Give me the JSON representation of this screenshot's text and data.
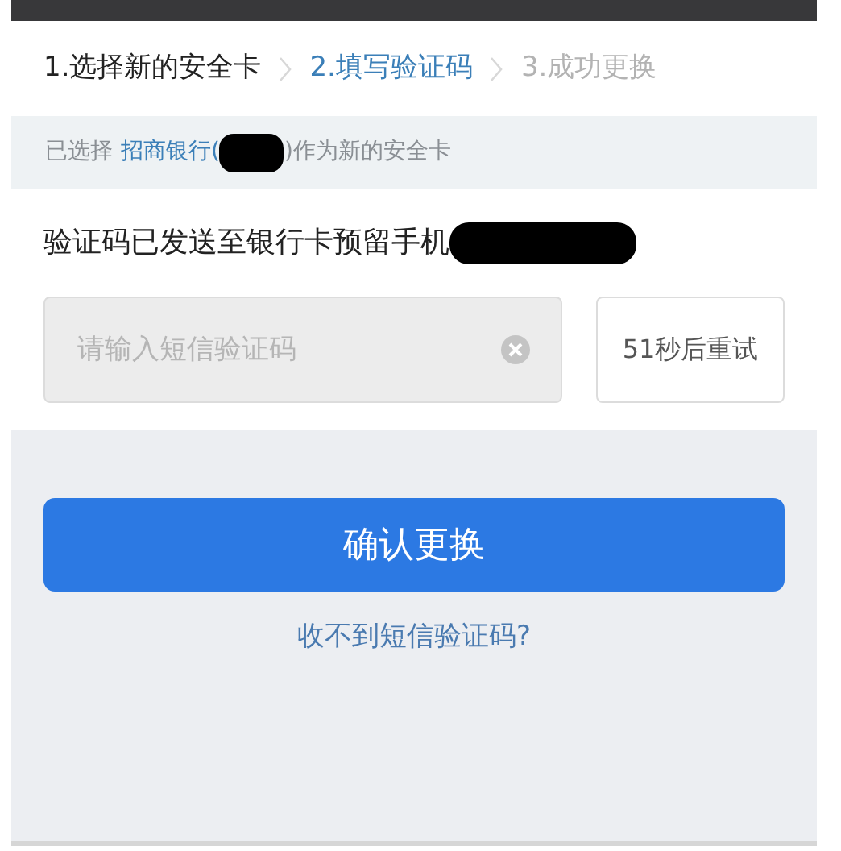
{
  "steps": [
    {
      "label": "1.选择新的安全卡",
      "kind": "done"
    },
    {
      "label": "2.填写验证码",
      "kind": "current"
    },
    {
      "label": "3.成功更换",
      "kind": "pending"
    }
  ],
  "notice": {
    "prefix": "已选择",
    "bank": "招商银行(",
    "suffix": ")作为新的安全卡"
  },
  "message": "验证码已发送至银行卡预留手机",
  "code_field": {
    "placeholder": "请输入短信验证码"
  },
  "retry_button": {
    "label": "51秒后重试",
    "disabled": true
  },
  "confirm_button": "确认更换",
  "help_link": "收不到短信验证码?"
}
